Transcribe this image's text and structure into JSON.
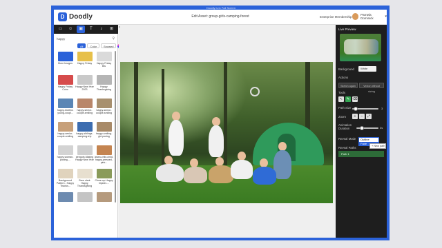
{
  "browser": {
    "caption": "Doodly is in Full Screen"
  },
  "header": {
    "logo": "Doodly",
    "title": "Edit Asset: group-girls-camping-forest",
    "membership": "Enterprise Membership",
    "user_name": "Parnela Dominick"
  },
  "sidebar": {
    "tabs": [
      {
        "icon": "image-icon"
      },
      {
        "icon": "people-icon"
      },
      {
        "icon": "props-icon",
        "active": true
      },
      {
        "icon": "text-icon"
      },
      {
        "icon": "music-icon"
      },
      {
        "icon": "cart-icon"
      }
    ],
    "search_value": "happy",
    "filters": [
      {
        "label": "All",
        "active": true
      },
      {
        "label": "Color",
        "active": false
      },
      {
        "label": "Snowed",
        "active": false
      }
    ],
    "items": [
      {
        "label": "More Images",
        "color": "#2b62d9"
      },
      {
        "label": "Happy Friday",
        "color": "#e7c04a"
      },
      {
        "label": "Happy Friday Bw",
        "color": "#dadada"
      },
      {
        "label": "Happy Friday Color",
        "color": "#d64b4b"
      },
      {
        "label": "Happy New Year 2023",
        "color": "#c9c9c9"
      },
      {
        "label": "Happy Thanksgiving",
        "color": "#b5b5b5"
      },
      {
        "label": "happy-excited-young-coupl...",
        "color": "#5b86b5"
      },
      {
        "label": "happy-senior-couple-smiling",
        "color": "#b9876b"
      },
      {
        "label": "happy-senior-couple-smiling",
        "color": "#a8906f"
      },
      {
        "label": "happy-senior-couple-smiling",
        "color": "#c7a07a"
      },
      {
        "label": "happy-siblings-camping-trip",
        "color": "#3d6db0"
      },
      {
        "label": "happy-smiling-girl-posing",
        "color": "#a88a68"
      },
      {
        "label": "happy-woman-posing-...",
        "color": "#d3d3d3"
      },
      {
        "label": "penguin-Making Happy New Year",
        "color": "#cfcfcf"
      },
      {
        "label": "asian-child-child-happy-pressed-pink...",
        "color": "#c48450"
      },
      {
        "label": "Background Pattern - Happy Thanks...",
        "color": "#e0d3bd"
      },
      {
        "label": "Bree clark Happy Thanksgiving",
        "color": "#e7dfcf"
      },
      {
        "label": "Close-up-Happy hipster-...",
        "color": "#8a9b5a"
      },
      {
        "label": "",
        "color": "#6d8bb0"
      },
      {
        "label": "",
        "color": "#c4c4c4"
      },
      {
        "label": "",
        "color": "#b59a7d"
      }
    ],
    "add_label": "+"
  },
  "canvas": {
    "image_name": "group-girls-camping-forest"
  },
  "panel": {
    "title": "Live Preview",
    "background_label": "Background",
    "background_value": "White",
    "actions_label": "Actions",
    "action_1": "Sketch again",
    "action_2": "Vector without sizing",
    "tools_label": "Tools",
    "path_size_label": "Path Size",
    "path_size_value": "3",
    "zoom_label": "Zoom",
    "animation_duration_label": "Animation Duration",
    "animation_duration_value": "3s",
    "reveal_mode_label": "Reveal Mode",
    "reveal_mode_options": [
      "Outline",
      "Fade"
    ],
    "new_path_label": "New path",
    "reveal_paths_label": "Reveal Paths",
    "path_item": "Path 1"
  }
}
